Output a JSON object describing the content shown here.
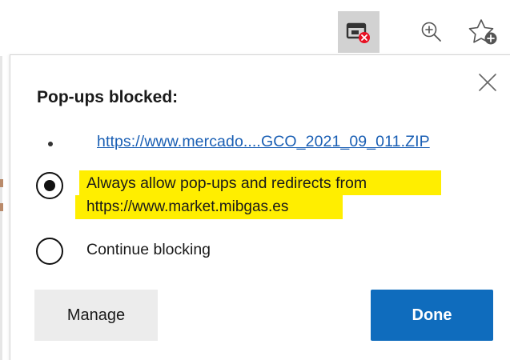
{
  "toolbar": {
    "popup_blocked_icon": "popup-blocked-icon",
    "zoom_icon": "zoom-in-icon",
    "favorites_icon": "add-favorite-icon"
  },
  "popup": {
    "title": "Pop-ups blocked:",
    "blocked_link": "https://www.mercado....GCO_2021_09_011.ZIP",
    "options": [
      {
        "line1": "Always allow pop-ups and redirects from",
        "line2": "https://www.market.mibgas.es",
        "selected": true
      },
      {
        "line1": "Continue blocking",
        "selected": false
      }
    ],
    "manage_label": "Manage",
    "done_label": "Done"
  },
  "colors": {
    "accent": "#0f6cbd",
    "link": "#1a5fb4",
    "highlight": "#ffee00",
    "active_toolbar_bg": "#d2d2d2",
    "blocked_badge": "#e81123"
  }
}
